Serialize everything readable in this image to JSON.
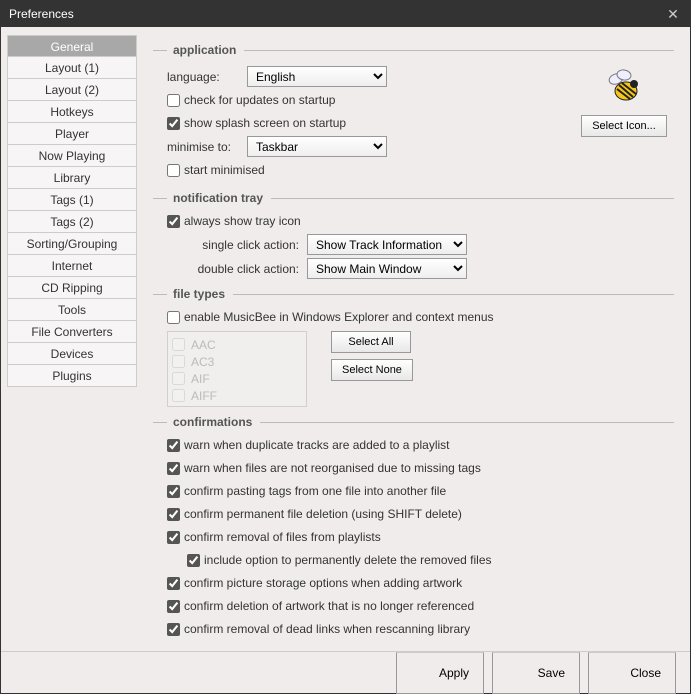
{
  "window": {
    "title": "Preferences"
  },
  "sidebar": [
    "General",
    "Layout (1)",
    "Layout (2)",
    "Hotkeys",
    "Player",
    "Now Playing",
    "Library",
    "Tags (1)",
    "Tags (2)",
    "Sorting/Grouping",
    "Internet",
    "CD Ripping",
    "Tools",
    "File Converters",
    "Devices",
    "Plugins"
  ],
  "sections": {
    "application": "application",
    "tray": "notification tray",
    "filetypes": "file types",
    "confirmations": "confirmations"
  },
  "app": {
    "language_label": "language:",
    "language_value": "English",
    "check_updates": "check for updates on startup",
    "show_splash": "show splash screen on startup",
    "minimise_label": "minimise to:",
    "minimise_value": "Taskbar",
    "start_minimised": "start minimised",
    "select_icon": "Select Icon..."
  },
  "tray": {
    "always_show": "always show tray icon",
    "single_label": "single click action:",
    "single_value": "Show Track Information",
    "double_label": "double click action:",
    "double_value": "Show Main Window"
  },
  "filetypes": {
    "enable": "enable MusicBee in Windows Explorer and context menus",
    "list": [
      "AAC",
      "AC3",
      "AIF",
      "AIFF"
    ],
    "select_all": "Select All",
    "select_none": "Select None"
  },
  "conf": [
    "warn when duplicate tracks are added to a playlist",
    "warn when files are not reorganised due to missing tags",
    "confirm pasting tags from one file into another file",
    "confirm permanent file deletion (using SHIFT delete)",
    "confirm removal of files from playlists",
    "include option to permanently delete the removed files",
    "confirm picture storage options when adding artwork",
    "confirm deletion of artwork that is no longer referenced",
    "confirm removal of dead links when rescanning library"
  ],
  "footer": {
    "apply": "Apply",
    "save": "Save",
    "close": "Close"
  }
}
